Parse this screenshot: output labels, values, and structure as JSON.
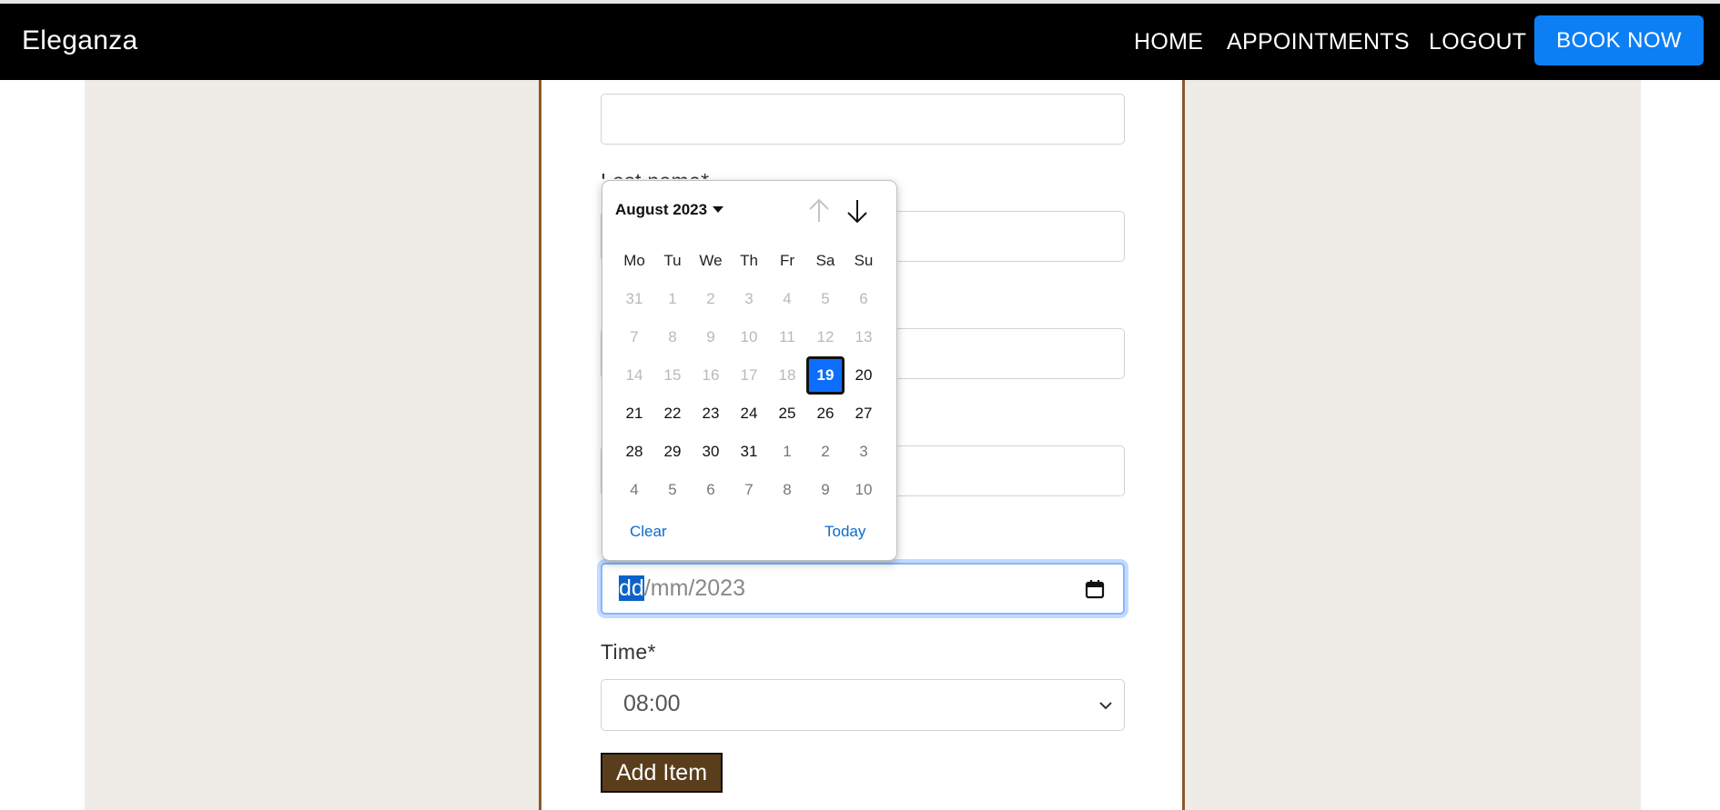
{
  "brand": "Eleganza",
  "nav": {
    "home": "HOME",
    "appointments": "APPOINTMENTS",
    "logout": "LOGOUT",
    "book_now": "BOOK NOW"
  },
  "form": {
    "last_name_label": "Last name*",
    "time_label": "Time*",
    "time_value": "08:00",
    "date_value_day": "dd",
    "date_value_rest": "/mm/2023",
    "add_item": "Add Item"
  },
  "calendar": {
    "month_label": "August 2023",
    "weekdays": [
      "Mo",
      "Tu",
      "We",
      "Th",
      "Fr",
      "Sa",
      "Su"
    ],
    "weeks": [
      [
        {
          "d": "31",
          "s": "dim"
        },
        {
          "d": "1",
          "s": "dim"
        },
        {
          "d": "2",
          "s": "dim"
        },
        {
          "d": "3",
          "s": "dim"
        },
        {
          "d": "4",
          "s": "dim"
        },
        {
          "d": "5",
          "s": "dim"
        },
        {
          "d": "6",
          "s": "dim"
        }
      ],
      [
        {
          "d": "7",
          "s": "dim"
        },
        {
          "d": "8",
          "s": "dim"
        },
        {
          "d": "9",
          "s": "dim"
        },
        {
          "d": "10",
          "s": "dim"
        },
        {
          "d": "11",
          "s": "dim"
        },
        {
          "d": "12",
          "s": "dim"
        },
        {
          "d": "13",
          "s": "dim"
        }
      ],
      [
        {
          "d": "14",
          "s": "dim"
        },
        {
          "d": "15",
          "s": "dim"
        },
        {
          "d": "16",
          "s": "dim"
        },
        {
          "d": "17",
          "s": "dim"
        },
        {
          "d": "18",
          "s": "dim"
        },
        {
          "d": "19",
          "s": "selected"
        },
        {
          "d": "20",
          "s": "active"
        }
      ],
      [
        {
          "d": "21",
          "s": "active"
        },
        {
          "d": "22",
          "s": "active"
        },
        {
          "d": "23",
          "s": "active"
        },
        {
          "d": "24",
          "s": "active"
        },
        {
          "d": "25",
          "s": "active"
        },
        {
          "d": "26",
          "s": "active"
        },
        {
          "d": "27",
          "s": "active"
        }
      ],
      [
        {
          "d": "28",
          "s": "active"
        },
        {
          "d": "29",
          "s": "active"
        },
        {
          "d": "30",
          "s": "active"
        },
        {
          "d": "31",
          "s": "active"
        },
        {
          "d": "1",
          "s": "next"
        },
        {
          "d": "2",
          "s": "next"
        },
        {
          "d": "3",
          "s": "next"
        }
      ],
      [
        {
          "d": "4",
          "s": "next"
        },
        {
          "d": "5",
          "s": "next"
        },
        {
          "d": "6",
          "s": "next"
        },
        {
          "d": "7",
          "s": "next"
        },
        {
          "d": "8",
          "s": "next"
        },
        {
          "d": "9",
          "s": "next"
        },
        {
          "d": "10",
          "s": "next"
        }
      ]
    ],
    "clear": "Clear",
    "today": "Today"
  },
  "colors": {
    "navbar": "#000000",
    "book_button": "#0d7ff5",
    "side_panel": "#efebe7",
    "card_border": "#8b5a2b",
    "add_button": "#5a3e1c",
    "selected_day": "#0d6efd"
  },
  "icons": {
    "calendar": "calendar-icon",
    "month_up": "arrow-up-icon",
    "month_down": "arrow-down-icon",
    "select": "chevron-down-icon"
  }
}
